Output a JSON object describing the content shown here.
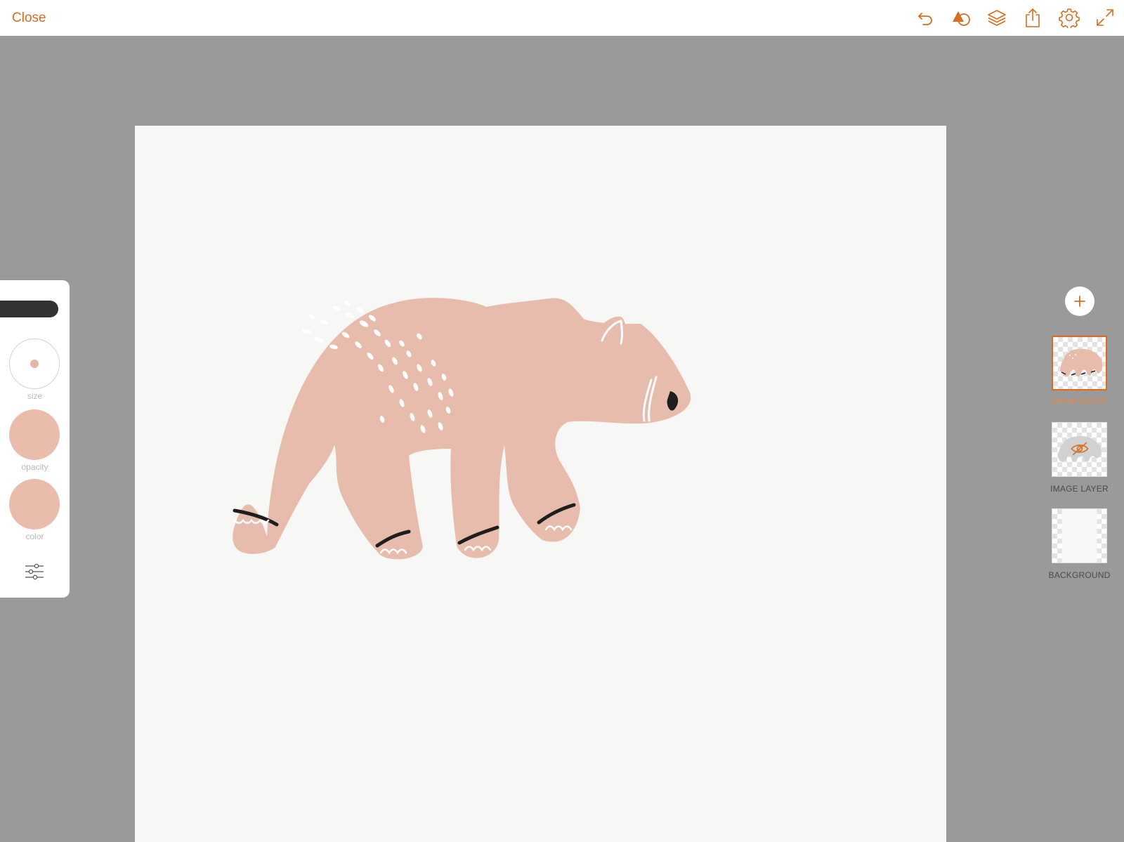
{
  "topbar": {
    "close_label": "Close",
    "icons": [
      "undo-icon",
      "shapes-icon",
      "layers-icon",
      "share-icon",
      "settings-icon",
      "fullscreen-icon"
    ]
  },
  "brush_panel": {
    "size_label": "size",
    "opacity_label": "opacity",
    "color_label": "color",
    "brush_color": "#e9bcab"
  },
  "layers": [
    {
      "name": "DRAW LAYER",
      "active": true
    },
    {
      "name": "IMAGE LAYER",
      "active": false,
      "hidden": true
    },
    {
      "name": "BACKGROUND",
      "active": false
    }
  ],
  "colors": {
    "accent": "#d96c1e",
    "bear": "#e8bcac",
    "canvas": "#f7f7f5",
    "workspace": "#9a9a9a"
  }
}
